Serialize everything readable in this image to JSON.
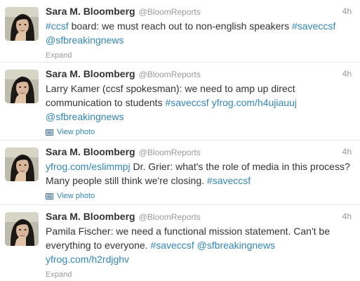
{
  "tweets": [
    {
      "fullname": "Sara M. Bloomberg",
      "username": "@BloomReports",
      "time": "4h",
      "segments": [
        {
          "t": "#ccsf",
          "link": true
        },
        {
          "t": " board: we must reach out to non-english speakers ",
          "link": false
        },
        {
          "t": "#saveccsf",
          "link": true
        },
        {
          "t": " ",
          "link": false
        },
        {
          "t": "@sfbreakingnews",
          "link": true
        }
      ],
      "footer": "Expand",
      "footer_type": "expand"
    },
    {
      "fullname": "Sara M. Bloomberg",
      "username": "@BloomReports",
      "time": "4h",
      "segments": [
        {
          "t": "Larry Kamer (ccsf spokesman): we need to amp up direct communication to students ",
          "link": false
        },
        {
          "t": "#saveccsf",
          "link": true
        },
        {
          "t": " ",
          "link": false
        },
        {
          "t": "yfrog.com/h4ujiauuj",
          "link": true
        },
        {
          "t": " ",
          "link": false
        },
        {
          "t": "@sfbreakingnews",
          "link": true
        }
      ],
      "footer": "View photo",
      "footer_type": "photo"
    },
    {
      "fullname": "Sara M. Bloomberg",
      "username": "@BloomReports",
      "time": "4h",
      "segments": [
        {
          "t": "yfrog.com/eslimmpj",
          "link": true
        },
        {
          "t": " Dr. Grier: what's the role of media in this process? Many people still think we're closing. ",
          "link": false
        },
        {
          "t": "#saveccsf",
          "link": true
        }
      ],
      "footer": "View photo",
      "footer_type": "photo"
    },
    {
      "fullname": "Sara M. Bloomberg",
      "username": "@BloomReports",
      "time": "4h",
      "segments": [
        {
          "t": "Pamila Fischer: we need a functional mission statement. Can't be everything to everyone. ",
          "link": false
        },
        {
          "t": "#saveccsf",
          "link": true
        },
        {
          "t": " ",
          "link": false
        },
        {
          "t": "@sfbreakingnews",
          "link": true
        },
        {
          "t": " ",
          "link": false
        },
        {
          "t": "yfrog.com/h2rdjghv",
          "link": true
        }
      ],
      "footer": "Expand",
      "footer_type": "expand"
    }
  ],
  "colors": {
    "link": "#3286b9",
    "name": "#333333",
    "muted": "#999999"
  },
  "icons": {
    "avatar": "user-avatar-photo",
    "photo": "photo-icon"
  }
}
